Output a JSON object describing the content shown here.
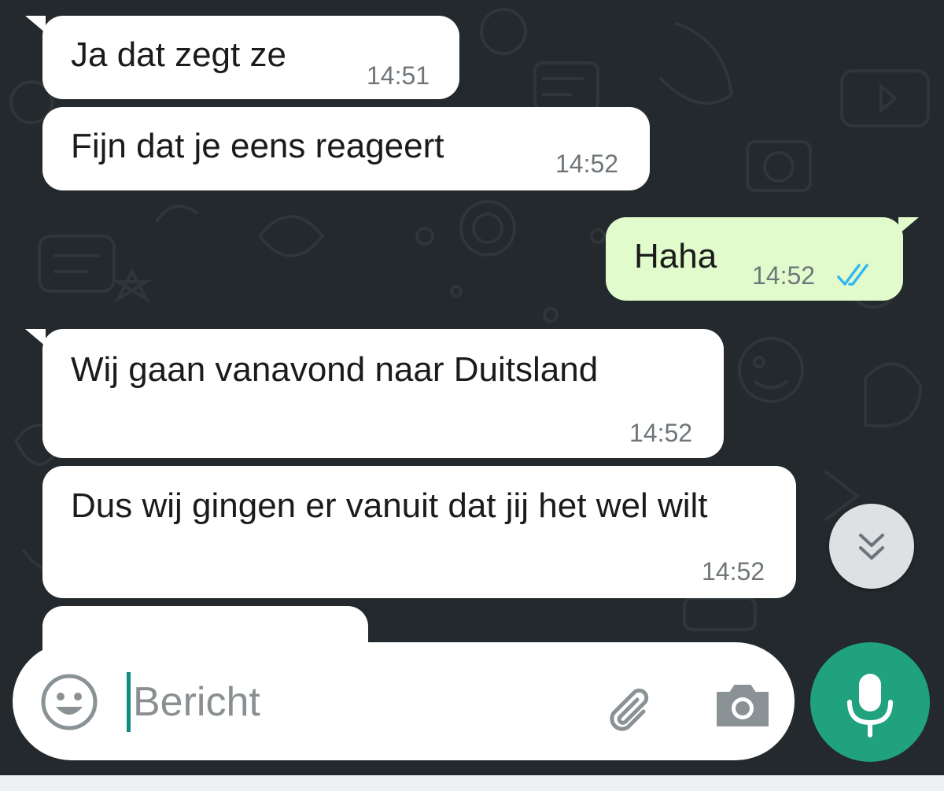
{
  "messages": [
    {
      "direction": "in",
      "text": "Ja dat zegt ze",
      "time": "14:51"
    },
    {
      "direction": "in",
      "text": "Fijn dat je eens reageert",
      "time": "14:52"
    },
    {
      "direction": "out",
      "text": "Haha",
      "time": "14:52",
      "status": "read"
    },
    {
      "direction": "in",
      "text": "Wij gaan vanavond naar Duitsland",
      "time": "14:52"
    },
    {
      "direction": "in",
      "text": "Dus wij gingen er vanuit dat jij het wel wilt",
      "time": "14:52"
    }
  ],
  "composer": {
    "placeholder": "Bericht",
    "value": "",
    "emoji_icon": "emoji-icon",
    "attach_icon": "paperclip-icon",
    "camera_icon": "camera-icon"
  },
  "mic_button": {
    "icon": "microphone-icon"
  },
  "scroll_button": {
    "icon": "double-chevron-down-icon"
  },
  "colors": {
    "background": "#23292c",
    "incoming_bubble": "#ffffff",
    "outgoing_bubble": "#e2fbcd",
    "accent": "#1fa27d",
    "read_ticks": "#34b7f1"
  }
}
